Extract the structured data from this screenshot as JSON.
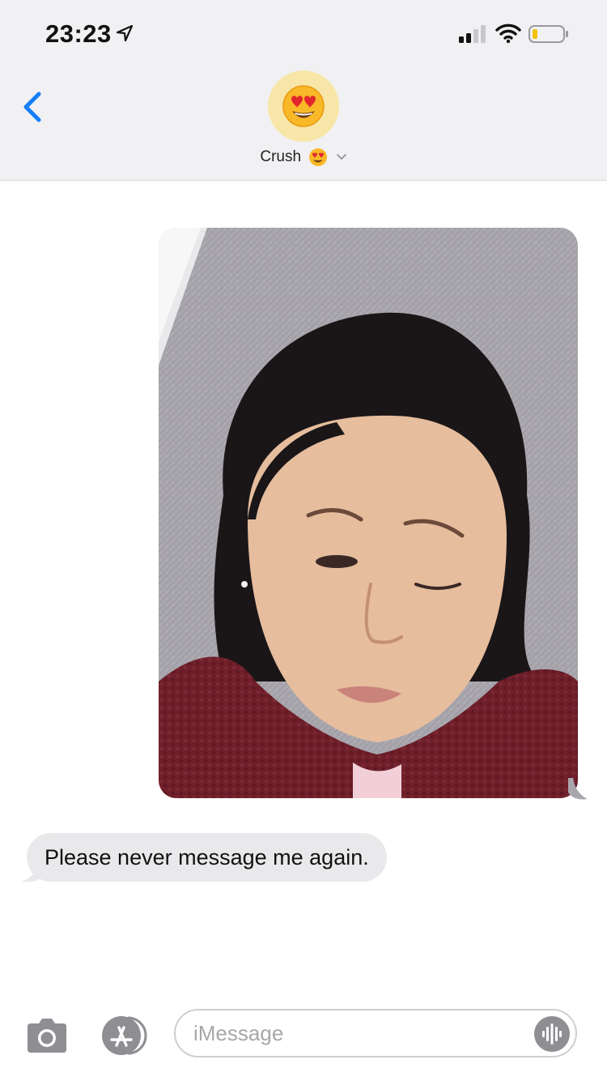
{
  "status_bar": {
    "time": "23:23"
  },
  "header": {
    "contact_name": "Crush"
  },
  "conversation": {
    "incoming_message": "Please never message me again."
  },
  "input_bar": {
    "placeholder": "iMessage"
  },
  "icons": {
    "back": "chevron-left-icon",
    "avatar": "heart-eyes-emoji",
    "camera": "camera-icon",
    "apps": "app-store-icon",
    "audio": "waveform-icon"
  },
  "colors": {
    "accent": "#147efb",
    "header_bg": "#f1f1f3",
    "incoming_bubble": "#e9e9eb",
    "avatar_bg": "#f8e6a8",
    "battery_level": "#f2c40f"
  }
}
